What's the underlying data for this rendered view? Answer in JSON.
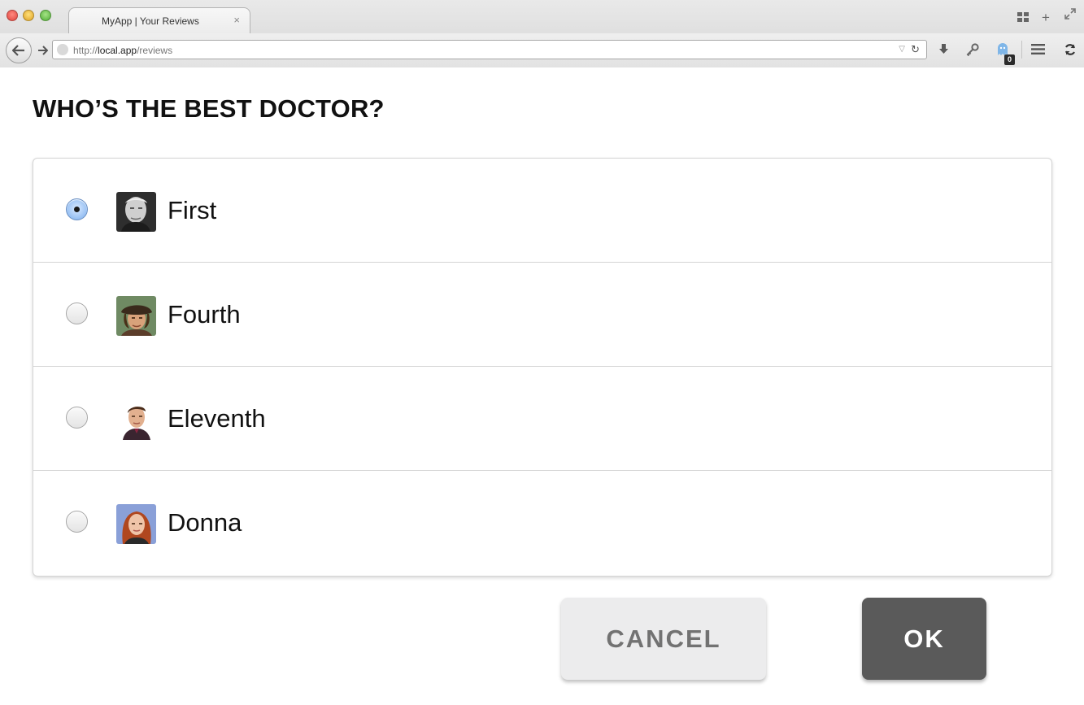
{
  "browser": {
    "tab_title": "MyApp | Your Reviews",
    "tab_close": "×",
    "url_scheme": "http://",
    "url_host": "local.app",
    "url_path": "/reviews",
    "extension_badge": "0"
  },
  "form": {
    "question": "WHO’S THE BEST DOCTOR?",
    "options": [
      {
        "label": "First",
        "selected": true
      },
      {
        "label": "Fourth",
        "selected": false
      },
      {
        "label": "Eleventh",
        "selected": false
      },
      {
        "label": "Donna",
        "selected": false
      }
    ],
    "cancel_label": "CANCEL",
    "ok_label": "OK"
  },
  "colors": {
    "ok_button_bg": "#5a5a5a",
    "cancel_button_bg": "#ececed",
    "radio_selected": "#97c0f3"
  }
}
